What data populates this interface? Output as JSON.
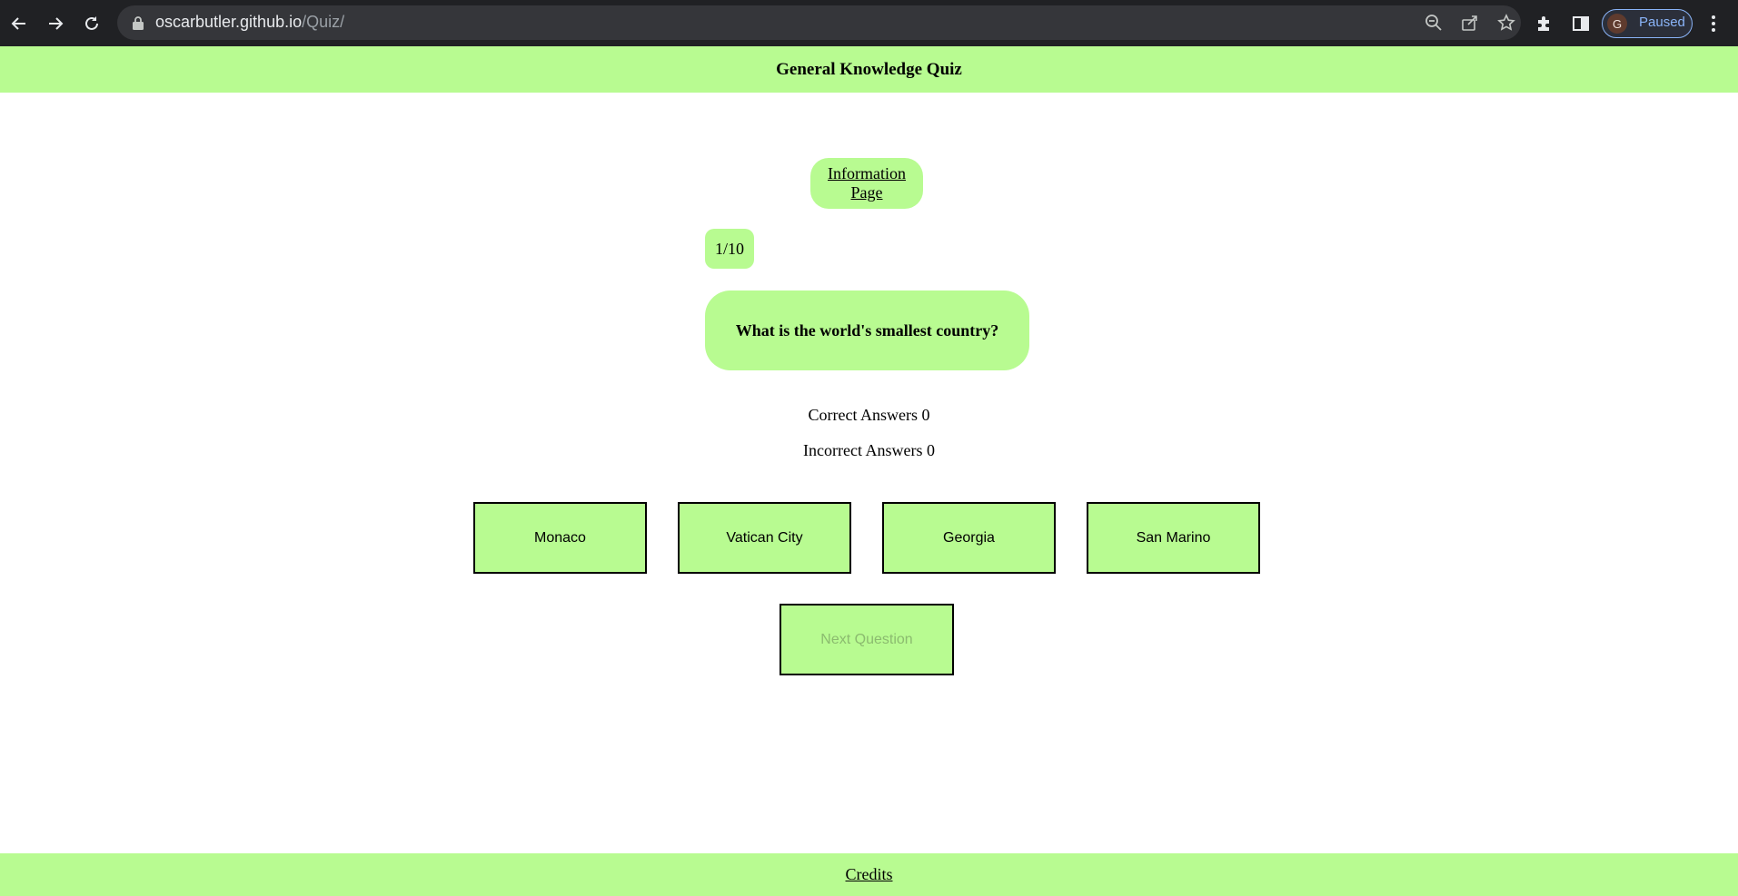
{
  "browser": {
    "url_host": "oscarbutler.github.io",
    "url_path": "/Quiz/",
    "profile_initial": "G",
    "profile_status": "Paused",
    "icons": {
      "back": "arrow-left",
      "forward": "arrow-right",
      "reload": "reload",
      "lock": "lock",
      "zoom": "zoom-out",
      "share": "share",
      "bookmark": "star",
      "extensions": "puzzle",
      "side_panel": "side-panel",
      "menu": "kebab-menu"
    },
    "colors": {
      "chrome_bg": "#202124",
      "omnibox_bg": "#35363a",
      "profile_accent": "#8ab4f8"
    }
  },
  "page": {
    "title": "General Knowledge Quiz",
    "info_link": "Information Page",
    "counter": "1/10",
    "question": "What is the world's smallest country?",
    "correct_label": "Correct Answers 0",
    "incorrect_label": "Incorrect Answers 0",
    "answers": [
      "Monaco",
      "Vatican City",
      "Georgia",
      "San Marino"
    ],
    "next_button": "Next Question",
    "footer_link": "Credits",
    "colors": {
      "accent": "#b8fb91",
      "disabled_text": "#8bbb6f"
    }
  }
}
